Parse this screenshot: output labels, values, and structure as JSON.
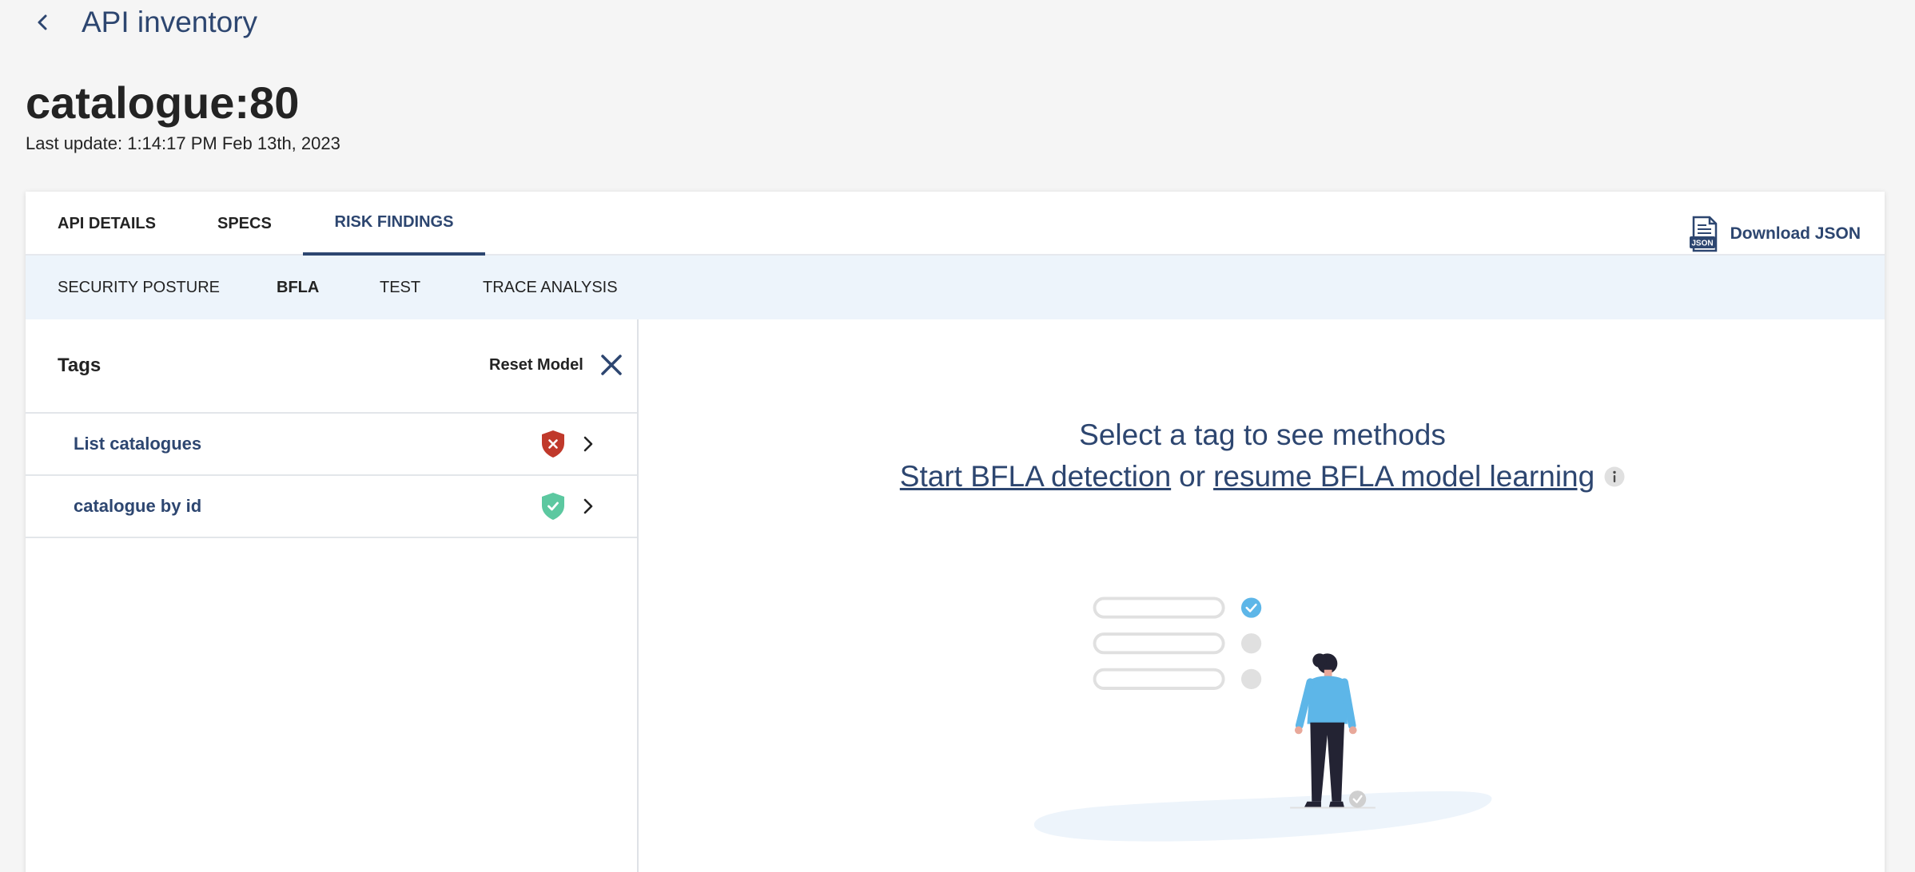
{
  "header": {
    "back_title": "API inventory",
    "page_title": "catalogue:80",
    "last_update": "Last update: 1:14:17 PM Feb 13th, 2023"
  },
  "tabs": [
    {
      "label": "API DETAILS",
      "active": false
    },
    {
      "label": "SPECS",
      "active": false
    },
    {
      "label": "RISK FINDINGS",
      "active": true
    }
  ],
  "download": {
    "label": "Download JSON",
    "icon": "json-file-icon",
    "icon_text": "JSON"
  },
  "subtabs": [
    {
      "label": "SECURITY POSTURE",
      "active": false
    },
    {
      "label": "BFLA",
      "active": true
    },
    {
      "label": "TEST",
      "active": false
    },
    {
      "label": "TRACE ANALYSIS",
      "active": false
    }
  ],
  "tags_panel": {
    "title": "Tags",
    "reset_label": "Reset Model",
    "items": [
      {
        "label": "List catalogues",
        "status": "risk",
        "icon": "shield-x-icon",
        "color": "#c0392b"
      },
      {
        "label": "catalogue by id",
        "status": "ok",
        "icon": "shield-check-icon",
        "color": "#5cc8a0"
      }
    ]
  },
  "empty_state": {
    "title": "Select a tag to see methods",
    "start_link": "Start BFLA detection",
    "or_text": "or",
    "resume_link": "resume BFLA model learning",
    "info_icon": "info-icon",
    "illustration": "person-checklist-illustration"
  },
  "colors": {
    "brand": "#2d4670",
    "subtab_bg": "#edf4fb",
    "page_bg": "#f5f5f5",
    "accent_blue": "#5db6e8"
  }
}
